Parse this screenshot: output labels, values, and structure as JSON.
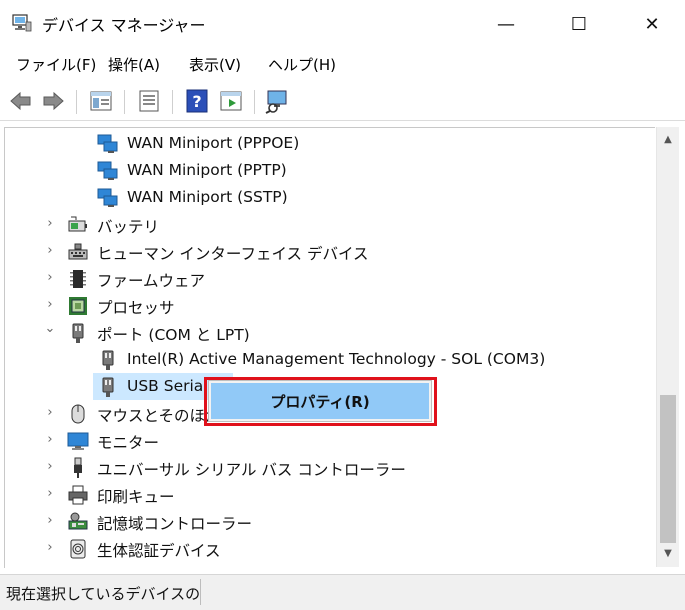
{
  "window": {
    "title": "デバイス マネージャー",
    "minimize": "—",
    "maximize": "☐",
    "close": "✕"
  },
  "menu": [
    "ファイル(F)",
    "操作(A)",
    "表示(V)",
    "ヘルプ(H)"
  ],
  "toolbar": {
    "icons": [
      "back-arrow-icon",
      "forward-arrow-icon",
      "show-hide-tree-icon",
      "properties-icon",
      "help-icon",
      "run-icon",
      "scan-hardware-icon"
    ]
  },
  "tree": {
    "rows": [
      {
        "label": "WAN Miniport (PPPOE)",
        "icon": "network-adapter-icon"
      },
      {
        "label": "WAN Miniport (PPTP)",
        "icon": "network-adapter-icon"
      },
      {
        "label": "WAN Miniport (SSTP)",
        "icon": "network-adapter-icon"
      },
      {
        "label": "バッテリ",
        "icon": "battery-icon",
        "chevron": "›"
      },
      {
        "label": "ヒューマン インターフェイス デバイス",
        "icon": "hid-icon",
        "chevron": "›"
      },
      {
        "label": "ファームウェア",
        "icon": "firmware-icon",
        "chevron": "›"
      },
      {
        "label": "プロセッサ",
        "icon": "processor-icon",
        "chevron": "›"
      },
      {
        "label": "ポート (COM と LPT)",
        "icon": "port-icon",
        "chevron": "⌄"
      },
      {
        "label": "Intel(R) Active Management Technology - SOL (COM3)",
        "icon": "port-icon"
      },
      {
        "label": "USB Serial",
        "icon": "port-icon"
      },
      {
        "label": "マウスとそのほか",
        "icon": "mouse-icon",
        "chevron": "›"
      },
      {
        "label": "モニター",
        "icon": "monitor-icon",
        "chevron": "›"
      },
      {
        "label": "ユニバーサル シリアル バス コントローラー",
        "icon": "usb-icon",
        "chevron": "›"
      },
      {
        "label": "印刷キュー",
        "icon": "printer-icon",
        "chevron": "›"
      },
      {
        "label": "記憶域コントローラー",
        "icon": "storage-controller-icon",
        "chevron": "›"
      },
      {
        "label": "生体認証デバイス",
        "icon": "biometric-icon",
        "chevron": "›"
      }
    ]
  },
  "context_menu": {
    "item": "プロパティ(R)",
    "outline_color": "#e0111b",
    "highlight_color": "#91c9f7"
  },
  "status": {
    "text": "現在選択しているデバイスの"
  },
  "scrollbar": {
    "up": "▲",
    "down": "▼"
  }
}
